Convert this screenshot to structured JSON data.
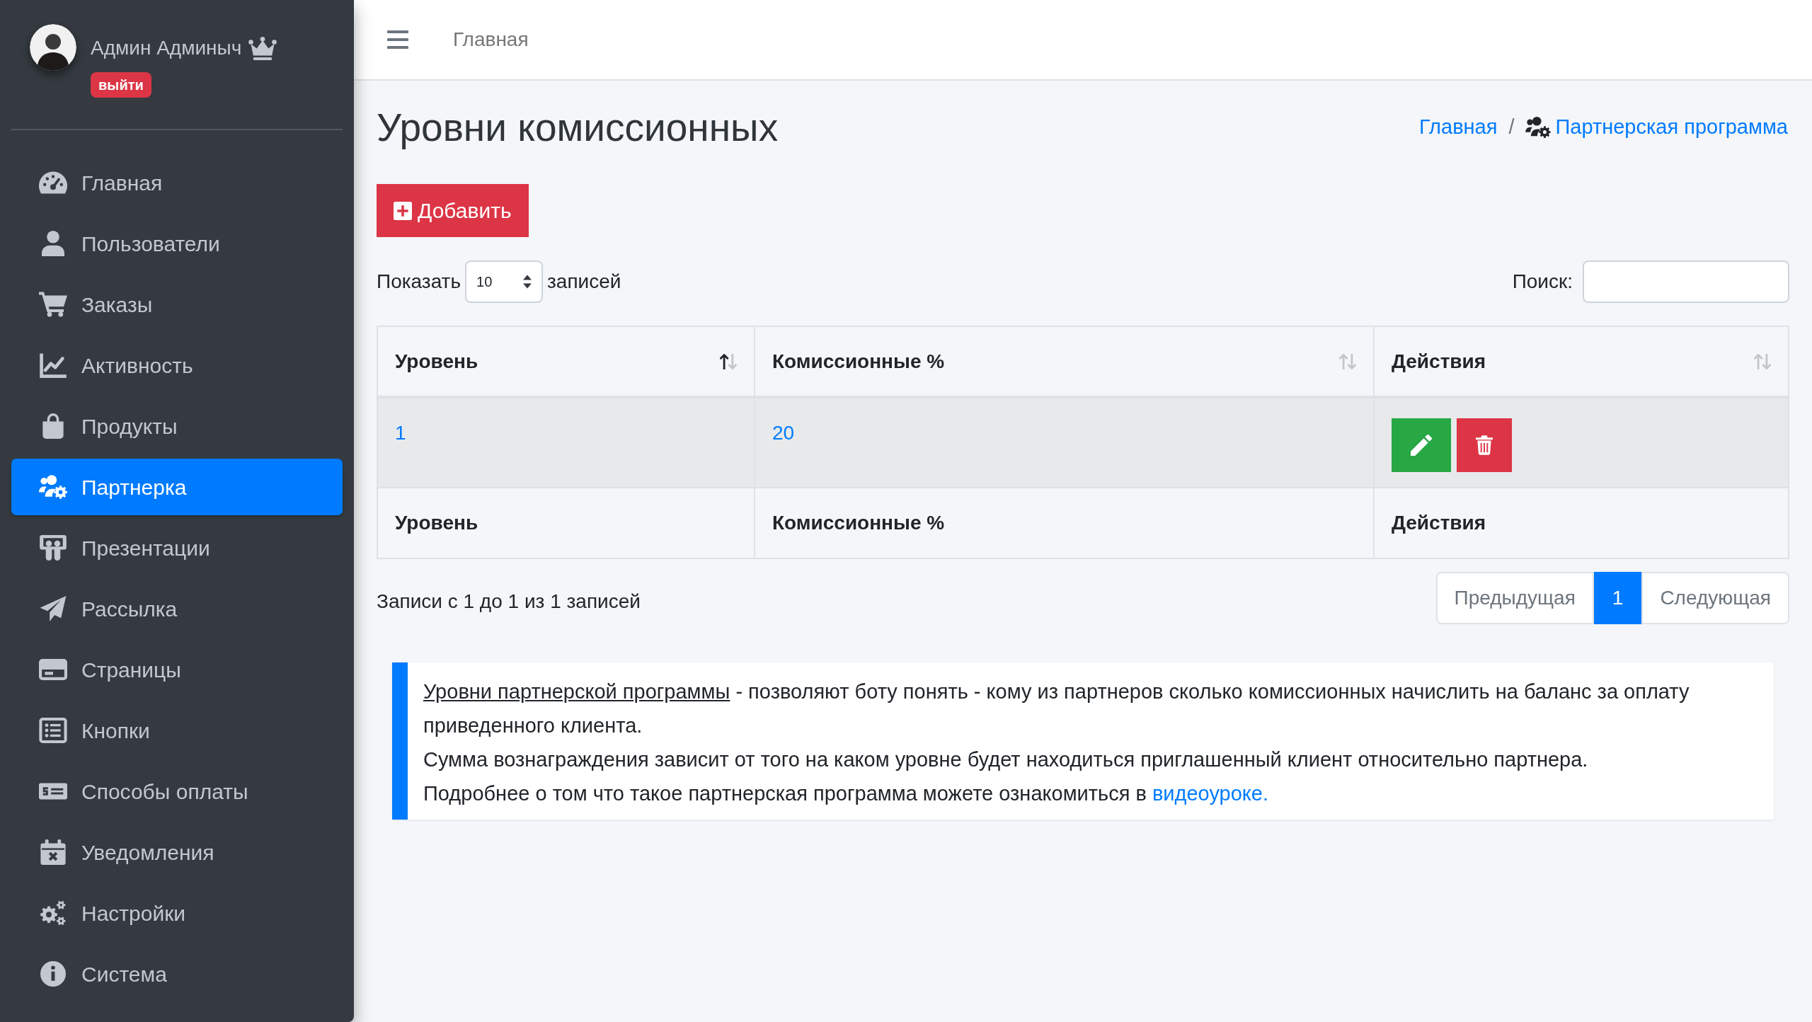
{
  "sidebar": {
    "user": {
      "name": "Админ Админыч",
      "logout": "выйти"
    },
    "items": [
      {
        "label": "Главная",
        "selected": false
      },
      {
        "label": "Пользователи",
        "selected": false
      },
      {
        "label": "Заказы",
        "selected": false
      },
      {
        "label": "Активность",
        "selected": false
      },
      {
        "label": "Продукты",
        "selected": false
      },
      {
        "label": "Партнерка",
        "selected": true
      },
      {
        "label": "Презентации",
        "selected": false
      },
      {
        "label": "Рассылка",
        "selected": false
      },
      {
        "label": "Страницы",
        "selected": false
      },
      {
        "label": "Кнопки",
        "selected": false
      },
      {
        "label": "Способы оплаты",
        "selected": false
      },
      {
        "label": "Уведомления",
        "selected": false
      },
      {
        "label": "Настройки",
        "selected": false
      },
      {
        "label": "Система",
        "selected": false
      }
    ]
  },
  "topbar": {
    "link": "Главная"
  },
  "page": {
    "title": "Уровни комиссионных",
    "breadcrumb": {
      "separator": "/",
      "items": [
        {
          "label": "Главная",
          "kind": "link"
        },
        {
          "label": "Партнерская программа",
          "kind": "icon_link"
        }
      ]
    }
  },
  "add_button": "Добавить",
  "length_control": {
    "label": "Показать",
    "value": "10",
    "suffix": "записей"
  },
  "search": {
    "label": "Поиск:"
  },
  "table": {
    "columns": [
      {
        "label": "Уровень",
        "sorted_ascending": true
      },
      {
        "label": "Комиссионные %",
        "sorted_ascending": false
      },
      {
        "label": "Действия",
        "sorted_ascending": false
      }
    ],
    "rows": [
      {
        "cells": [
          "1",
          "20"
        ]
      }
    ],
    "footer": [
      "Уровень",
      "Комиссионные %",
      "Действия"
    ]
  },
  "table_info": "Записи с 1 до 1 из 1 записей",
  "pagination": {
    "previous": {
      "label": "Предыдущая",
      "disabled": true
    },
    "pages": [
      {
        "label": "1",
        "selected": true
      }
    ],
    "next": {
      "label": "Следующая",
      "disabled": true
    }
  },
  "note": {
    "lines": [
      {
        "term": "Уровни партнерской программы",
        "text": "- позволяют боту понять - кому из партнеров сколько комиссионных начислить на баланс за оплату приведенного клиента."
      },
      {
        "text": "Сумма вознаграждения зависит от того на каком уровне будет находиться приглашенный клиент относительно партнера."
      },
      {
        "text": "Подробнее о том что такое партнерская программа можете ознакомиться в",
        "link": "видеоуроке."
      }
    ]
  }
}
